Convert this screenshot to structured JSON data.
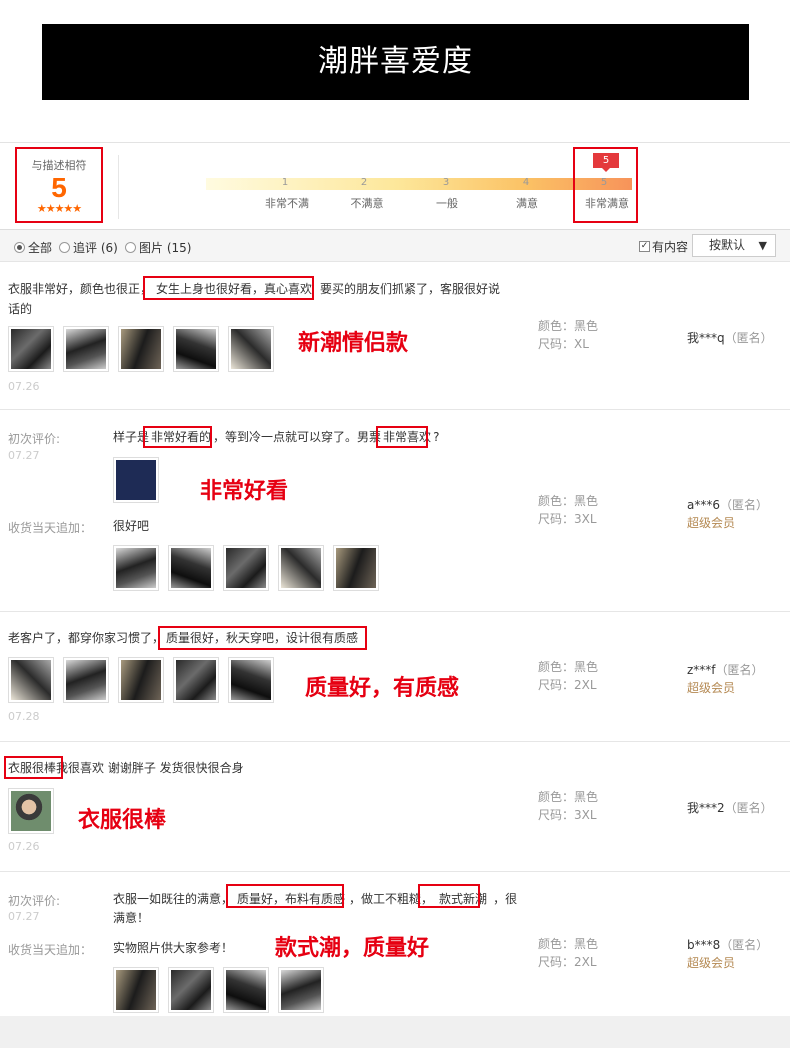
{
  "banner": {
    "title": "潮胖喜爱度"
  },
  "rating": {
    "label": "与描述相符",
    "score": "5",
    "stars": "★★★★★",
    "marker": "5",
    "scale": [
      {
        "num": "1",
        "label": "非常不满"
      },
      {
        "num": "2",
        "label": "不满意"
      },
      {
        "num": "3",
        "label": "一般"
      },
      {
        "num": "4",
        "label": "满意"
      },
      {
        "num": "5",
        "label": "非常满意"
      }
    ]
  },
  "filters": {
    "all": "全部",
    "followup": "追评 (6)",
    "images": "图片 (15)",
    "has_content": "有内容",
    "sort": "按默认"
  },
  "reviews": [
    {
      "text_a": "衣服非常好，颜色也很正，",
      "text_b": "女生上身也很好看，真心喜欢",
      "text_c": "要买的朋友们抓紧了，客服很好说",
      "text_d": "话的",
      "date": "07.26",
      "color": "颜色：黑色",
      "size": "尺码：XL",
      "user": "我***q",
      "anon": "（匿名）",
      "annotation": "新潮情侣款"
    },
    {
      "first_label": "初次评价:",
      "date": "07.27",
      "text_a": "样子是",
      "text_b": "非常好看的",
      "text_c": "，等到冷一点就可以穿了。男票",
      "text_d": "非常喜欢",
      "text_e": "?",
      "followup_label": "收货当天追加：",
      "followup_text": "很好吧",
      "color": "颜色：黑色",
      "size": "尺码：3XL",
      "user": "a***6",
      "anon": "（匿名）",
      "vip": "超级会员",
      "annotation": "非常好看"
    },
    {
      "text_a": "老客户了，都穿你家习惯了，",
      "text_b": "质量很好，秋天穿吧，设计很有质感",
      "date": "07.28",
      "color": "颜色：黑色",
      "size": "尺码：2XL",
      "user": "z***f",
      "anon": "（匿名）",
      "vip": "超级会员",
      "annotation": "质量好，有质感"
    },
    {
      "text_a": "衣服很棒",
      "text_b": "我很喜欢 谢谢胖子 发货很快很合身",
      "date": "07.26",
      "color": "颜色：黑色",
      "size": "尺码：3XL",
      "user": "我***2",
      "anon": "（匿名）",
      "annotation": "衣服很棒"
    },
    {
      "first_label": "初次评价:",
      "date": "07.27",
      "text_a": "衣服一如既往的满意，",
      "text_b": "质量好，布料有质感",
      "text_c": "，做工不粗糙，",
      "text_d": "款式新潮",
      "text_e": "，很",
      "text_f": "满意！",
      "followup_label": "收货当天追加：",
      "followup_text": "实物照片供大家参考！",
      "color": "颜色：黑色",
      "size": "尺码：2XL",
      "user": "b***8",
      "anon": "（匿名）",
      "vip": "超级会员",
      "annotation": "款式潮，质量好"
    }
  ],
  "colors": {
    "accent_red": "#e60012",
    "score_orange": "#ff6600",
    "vip_brown": "#b58a54"
  }
}
